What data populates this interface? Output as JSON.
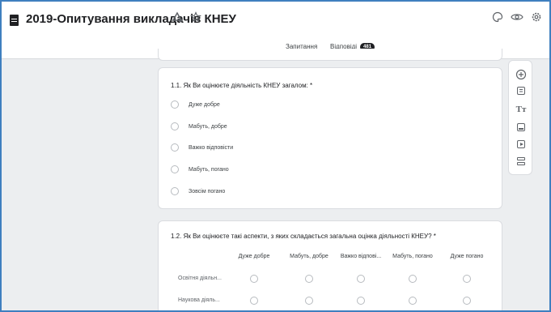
{
  "header": {
    "title": "2019-Опитування викладачів КНЕУ",
    "icons": [
      "document-icon",
      "move-to-folder-icon",
      "star-icon",
      "palette-icon",
      "preview-eye-icon",
      "settings-gear-icon"
    ]
  },
  "tabs": [
    {
      "label": "Запитання",
      "active": true
    },
    {
      "label": "Відповіді",
      "badge": "481",
      "active": false
    }
  ],
  "questions": {
    "q1": {
      "title": "1.1. Як Ви оцінюєте діяльність КНЕУ загалом: *",
      "options": [
        "Дуже добре",
        "Мабуть, добре",
        "Важко відповісти",
        "Мабуть, погано",
        "Зовсім погано"
      ]
    },
    "q2": {
      "title": "1.2. Як Ви оцінюєте такі аспекти, з яких складається загальна оцінка діяльності КНЕУ? *",
      "columns": [
        "Дуже добре",
        "Мабуть, добре",
        "Важко відпові...",
        "Мабуть, погано",
        "Дуже погано"
      ],
      "rows": [
        "Освітня діяльн...",
        "Наукова діяль..."
      ]
    }
  },
  "toolbar": {
    "items": [
      "add-question-icon",
      "import-questions-icon",
      "add-title-icon",
      "add-image-icon",
      "add-video-icon",
      "add-section-icon"
    ],
    "title_glyph": "Tт"
  },
  "colors": {
    "background": "#eceef0",
    "card": "#ffffff",
    "accent": "#202124",
    "frame_border": "#3f7fbf"
  }
}
